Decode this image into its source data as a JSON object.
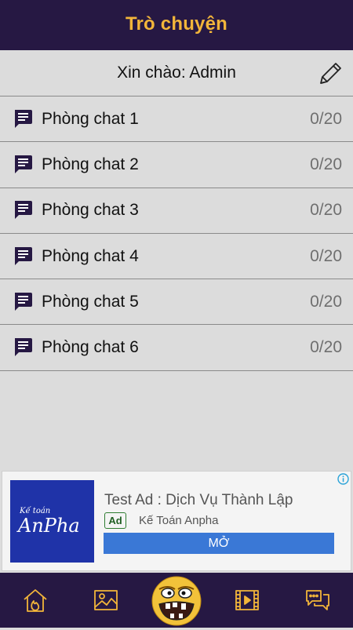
{
  "header": {
    "title": "Trò chuyện"
  },
  "greeting": {
    "text": "Xin chào: Admin"
  },
  "rooms": [
    {
      "name": "Phòng chat 1",
      "count": "0/20"
    },
    {
      "name": "Phòng chat 2",
      "count": "0/20"
    },
    {
      "name": "Phòng chat 3",
      "count": "0/20"
    },
    {
      "name": "Phòng chat 4",
      "count": "0/20"
    },
    {
      "name": "Phòng chat 5",
      "count": "0/20"
    },
    {
      "name": "Phòng chat 6",
      "count": "0/20"
    }
  ],
  "ad": {
    "title": "Test Ad : Dịch Vụ Thành Lập",
    "badge": "Ad",
    "advertiser": "Kế Toán Anpha",
    "cta": "MỞ",
    "image_text_small": "Kế toán",
    "image_text_large": "AnPha"
  },
  "tabbar": {
    "items": [
      {
        "icon": "home-icon"
      },
      {
        "icon": "image-icon"
      },
      {
        "icon": "emoji-face-icon"
      },
      {
        "icon": "film-icon"
      },
      {
        "icon": "chat-bubbles-icon"
      }
    ]
  },
  "colors": {
    "header_bg": "#261843",
    "title": "#f2b53a",
    "background": "#dcdcdc",
    "ad_button": "#3a78d6",
    "ad_image_bg": "#1f33a8"
  }
}
